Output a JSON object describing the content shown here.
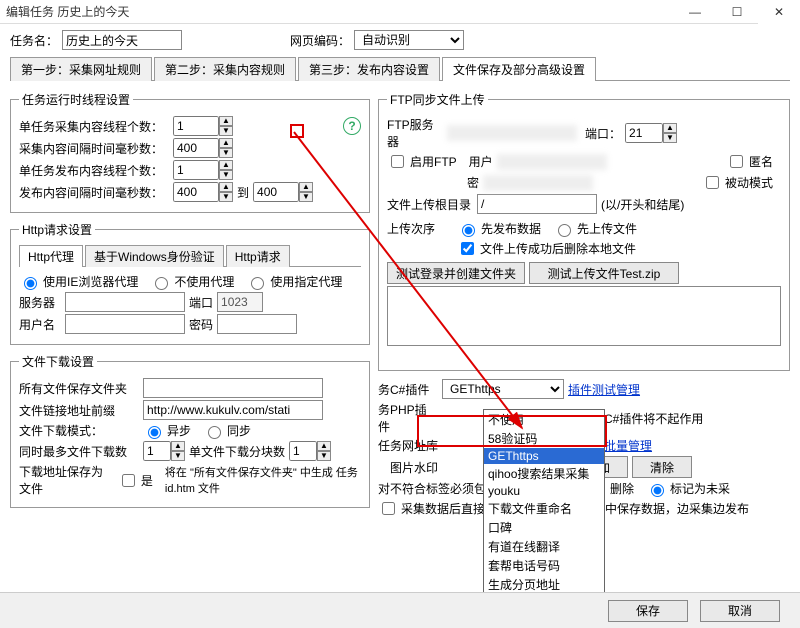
{
  "title": "编辑任务 历史上的今天",
  "window_buttons": {
    "min": "—",
    "max": "☐",
    "close": "✕"
  },
  "task_name_label": "任务名：",
  "task_name_value": "历史上的今天",
  "encoding_label": "网页编码：",
  "encoding_value": "自动识别",
  "tabs": {
    "items": [
      "第一步：采集网址规则",
      "第二步：采集内容规则",
      "第三步：发布内容设置",
      "文件保存及部分高级设置"
    ],
    "active": 3
  },
  "left": {
    "thread_group": "任务运行时线程设置",
    "thread_rows": [
      {
        "label": "单任务采集内容线程个数：",
        "value": "1"
      },
      {
        "label": "采集内容间隔时间毫秒数：",
        "value": "400"
      },
      {
        "label": "单任务发布内容线程个数：",
        "value": "1"
      },
      {
        "label": "发布内容间隔时间毫秒数：",
        "value": "400",
        "to_label": "到",
        "to_value": "400"
      }
    ],
    "http_group": "Http请求设置",
    "http_subtabs": [
      "Http代理",
      "基于Windows身份验证",
      "Http请求"
    ],
    "proxy_radios": [
      "使用IE浏览器代理",
      "不使用代理",
      "使用指定代理"
    ],
    "proxy_selected": 0,
    "server_label": "服务器",
    "port_label": "端口",
    "port_value": "1023",
    "user_label": "用户名",
    "pwd_label": "密码",
    "file_group": "文件下载设置",
    "save_folder_label": "所有文件保存文件夹",
    "prefix_label": "文件链接地址前缀",
    "prefix_value": "http://www.kukulv.com/stati",
    "mode_label": "文件下载模式：",
    "mode_opts": [
      "异步",
      "同步"
    ],
    "mode_selected": 0,
    "maxfiles_label": "同时最多文件下载数",
    "maxfiles_value": "1",
    "chunk_label": "单文件下载分块数",
    "chunk_value": "1",
    "save_as_label": "下载地址保存为文件",
    "save_as_opts": [
      "是"
    ],
    "save_as_note": "将在 \"所有文件保存文件夹\" 中生成    任务id.htm 文件"
  },
  "right": {
    "ftp_group": "FTP同步文件上传",
    "ftp_server_label": "FTP服务器",
    "ftp_port_label": "端口：",
    "ftp_port_value": "21",
    "enable_ftp": "启用FTP",
    "user_label": "用户",
    "anon": "匿名",
    "pwd_label": "密",
    "passive": "被动模式",
    "root_label": "文件上传根目录",
    "root_value": "/",
    "root_hint": "(以/开头和结尾)",
    "order_label": "上传次序",
    "order_opts": [
      "先发布数据",
      "先上传文件"
    ],
    "order_selected": 0,
    "delete_after": "文件上传成功后删除本地文件",
    "test_login": "测试登录并创建文件夹",
    "test_upload": "测试上传文件Test.zip",
    "cs_plugin_label": "务C#插件",
    "cs_plugin_value": "GEThttps",
    "cs_plugin_link": "插件测试管理",
    "php_plugin_label": "务PHP插件",
    "php_note": "使用后C#插件将不起作用",
    "netlib_label": "任务网址库",
    "netlib_link": "网址库批量管理",
    "watermark_label": "图片水印",
    "add_btn": "添加",
    "clear_btn": "清除",
    "unmatched_label": "对不符合标签必须包含",
    "unmatched_opts": [
      "删除",
      "标记为未采"
    ],
    "unmatched_selected": 1,
    "direct_pub": "采集数据后直接发布，不在采集数据库中保存数据，边采集边发布",
    "dropdown_opts": [
      "不使用",
      "58验证码",
      "GEThttps",
      "qihoo搜索结果采集",
      "youku",
      "下载文件重命名",
      "口碑",
      "有道在线翻译",
      "套帮电话号码",
      "生成分页地址"
    ]
  },
  "bottom": {
    "save": "保存",
    "cancel": "取消"
  }
}
